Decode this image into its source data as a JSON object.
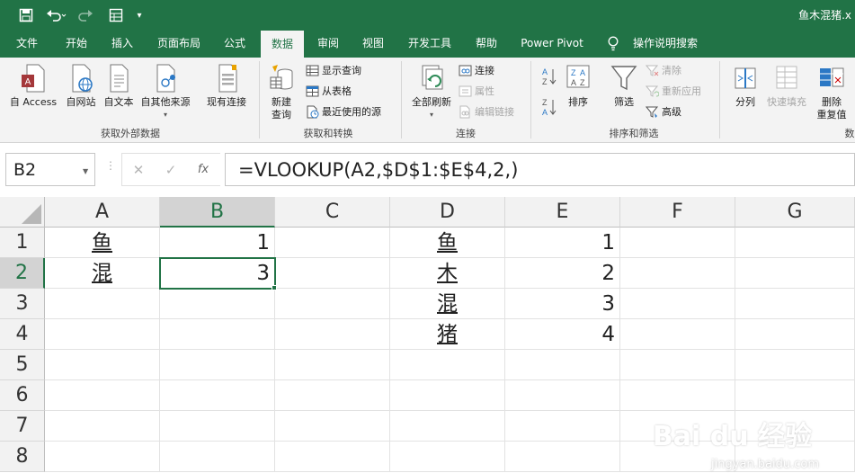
{
  "window": {
    "title": "鱼木混猪.x"
  },
  "quick_access": {
    "save": "save-icon",
    "undo": "undo-icon",
    "redo": "redo-icon",
    "form": "form-icon",
    "more": "▾"
  },
  "tabs": [
    "文件",
    "开始",
    "插入",
    "页面布局",
    "公式",
    "数据",
    "审阅",
    "视图",
    "开发工具",
    "帮助",
    "Power Pivot"
  ],
  "active_tab": "数据",
  "tell_me": "操作说明搜索",
  "ribbon": {
    "get_external": {
      "label": "获取外部数据",
      "buttons": [
        "自 Access",
        "自网站",
        "自文本",
        "自其他来源",
        "现有连接"
      ]
    },
    "get_transform": {
      "label": "获取和转换",
      "new_query": "新建\n查询",
      "items": [
        "显示查询",
        "从表格",
        "最近使用的源"
      ]
    },
    "connections": {
      "label": "连接",
      "refresh_all": "全部刷新",
      "items": [
        "连接",
        "属性",
        "编辑链接"
      ]
    },
    "sort_filter": {
      "label": "排序和筛选",
      "sort": "排序",
      "filter": "筛选",
      "items": [
        "清除",
        "重新应用",
        "高级"
      ]
    },
    "data_tools": {
      "label": "数",
      "split": "分列",
      "flash_fill": "快速填充",
      "remove_dup": "删除\n重复值"
    }
  },
  "formula_bar": {
    "name_box": "B2",
    "cancel": "✕",
    "enter": "✓",
    "fx": "fx",
    "formula": "=VLOOKUP(A2,$D$1:$E$4,2,)"
  },
  "sheet": {
    "columns": [
      "A",
      "B",
      "C",
      "D",
      "E",
      "F",
      "G"
    ],
    "rows": [
      "1",
      "2",
      "3",
      "4",
      "5",
      "6",
      "7",
      "8"
    ],
    "cells": {
      "A1": "鱼",
      "B1": "1",
      "D1": "鱼",
      "E1": "1",
      "A2": "混",
      "B2": "3",
      "D2": "木",
      "E2": "2",
      "D3": "混",
      "E3": "3",
      "D4": "猪",
      "E4": "4"
    },
    "selected_cell": "B2"
  },
  "watermark": {
    "main": "Bai du 经验",
    "sub": "jingyan.baidu.com"
  }
}
